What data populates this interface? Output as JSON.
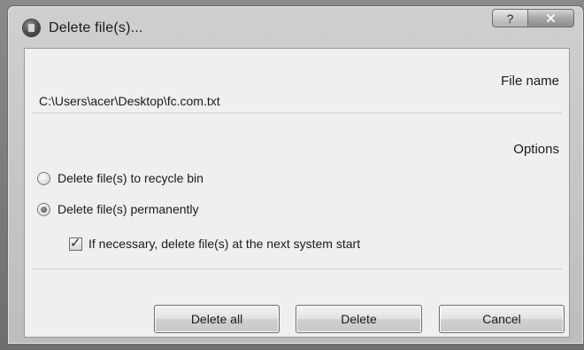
{
  "window": {
    "title": "Delete file(s)...",
    "help_label": "?",
    "close_label": "✕"
  },
  "file_section": {
    "label": "File name",
    "path": "C:\\Users\\acer\\Desktop\\fc.com.txt"
  },
  "options_section": {
    "label": "Options",
    "items": [
      {
        "label": "Delete file(s) to recycle bin",
        "type": "radio",
        "checked": false
      },
      {
        "label": "Delete file(s) permanently",
        "type": "radio",
        "checked": true
      },
      {
        "label": "If necessary, delete file(s) at the next system start",
        "type": "checkbox",
        "checked": true
      }
    ]
  },
  "buttons": {
    "delete_all": "Delete all",
    "delete": "Delete",
    "cancel": "Cancel"
  },
  "icons": {
    "app": "delete-app-icon",
    "check": "✓"
  }
}
